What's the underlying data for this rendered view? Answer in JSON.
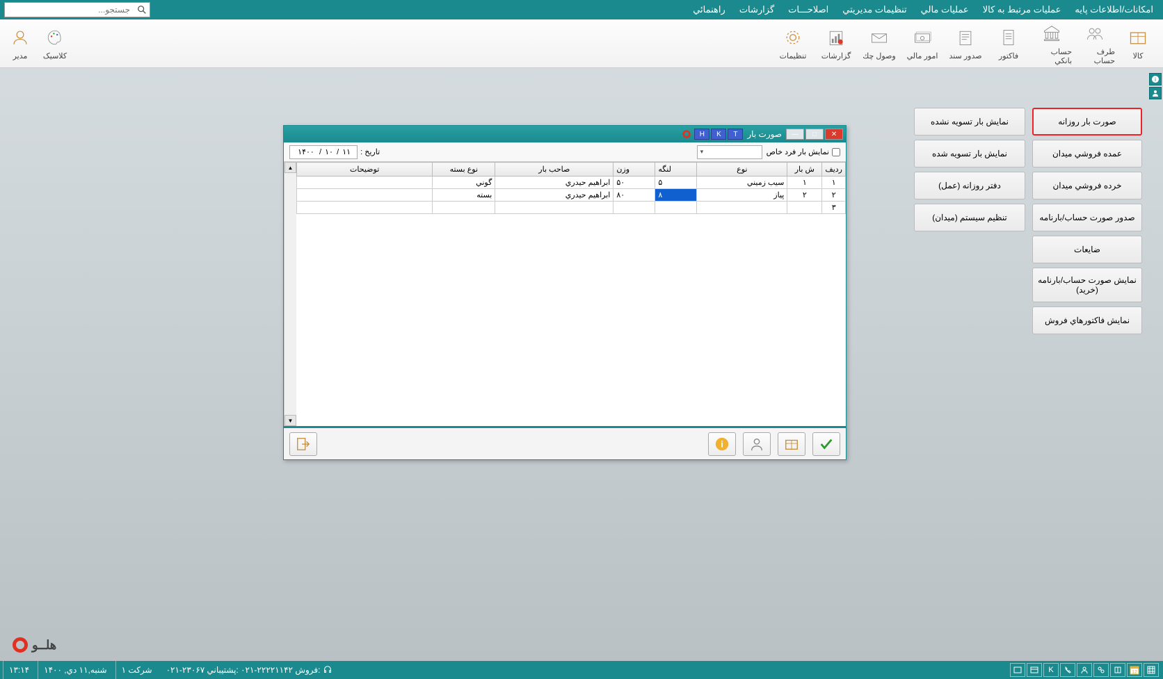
{
  "menubar": {
    "items": [
      "امکانات/اطلاعات پايه",
      "عمليات مرتبط به کالا",
      "عمليات مالي",
      "تنظيمات مديريتي",
      "اصلاحـــات",
      "گزارشات",
      "راهنمائي"
    ],
    "search_placeholder": "جستجو..."
  },
  "toolbar": {
    "items": [
      {
        "label": "کالا",
        "icon": "box-icon"
      },
      {
        "label": "طرف حساب",
        "icon": "contacts-icon"
      },
      {
        "label": "حساب بانکي",
        "icon": "bank-icon"
      },
      {
        "label": "فاکتور",
        "icon": "invoice-icon"
      },
      {
        "label": "صدور سند",
        "icon": "document-icon"
      },
      {
        "label": "امور مالي",
        "icon": "money-icon"
      },
      {
        "label": "وصول چك",
        "icon": "cheque-icon"
      },
      {
        "label": "گزارشات",
        "icon": "report-icon"
      },
      {
        "label": "تنظيمات",
        "icon": "gear-icon"
      }
    ],
    "left_items": [
      {
        "label": "کلاسيک",
        "icon": "palette-icon"
      },
      {
        "label": "مدير",
        "icon": "user-icon"
      }
    ]
  },
  "side_menu": {
    "col1": [
      "صورت بار روزانه",
      "عمده فروشي ميدان",
      "خرده فروشي ميدان",
      "صدور صورت حساب/بارنامه",
      "ضايعات",
      "نمايش صورت حساب/بارنامه (خريد)",
      "نمايش فاكتورهاي فروش"
    ],
    "col2": [
      "نمايش بار تسويه نشده",
      "نمايش بار تسويه شده",
      "دفتر روزانه (عمل)",
      "تنظيم سيستم (ميدان)"
    ],
    "active_index": 0
  },
  "dialog": {
    "title": "صورت بار",
    "tb_letters": [
      "T",
      "K",
      "H"
    ],
    "filter_label": "نمايش بار فرد خاص",
    "date_label": "تاريخ :",
    "date": {
      "d": "۱۱",
      "m": "۱۰",
      "y": "۱۴۰۰"
    },
    "columns": [
      "رديف",
      "ش بار",
      "نوع",
      "لنگه",
      "وزن",
      "صاحب بار",
      "نوع بسته",
      "توضيحات"
    ],
    "rows": [
      {
        "radif": "۱",
        "shbar": "۱",
        "noe": "سيب زميني",
        "lenge": "۵",
        "vazn": "۵۰",
        "saheb": "ابراهيم حيدري",
        "noebaste": "گوني",
        "tozihat": ""
      },
      {
        "radif": "۲",
        "shbar": "۲",
        "noe": "پياز",
        "lenge": "۸",
        "vazn": "۸۰",
        "saheb": "ابراهيم حيدري",
        "noebaste": "بسته",
        "tozihat": "",
        "selected_col": "lenge"
      },
      {
        "radif": "۳",
        "shbar": "",
        "noe": "",
        "lenge": "",
        "vazn": "",
        "saheb": "",
        "noebaste": "",
        "tozihat": ""
      }
    ]
  },
  "brand": "هلــو",
  "status": {
    "time": "۱۳:۱۴",
    "date": "شنبه,۱۱ دي, ۱۴۰۰",
    "company": "شركت ۱",
    "sales_label": "فروش:",
    "sales_phone": "۰۲۱-۲۲۲۲۱۱۴۲",
    "support_label": "پشتيباني:",
    "support_phone": "۰۲۱-۲۳۰۶۷"
  }
}
